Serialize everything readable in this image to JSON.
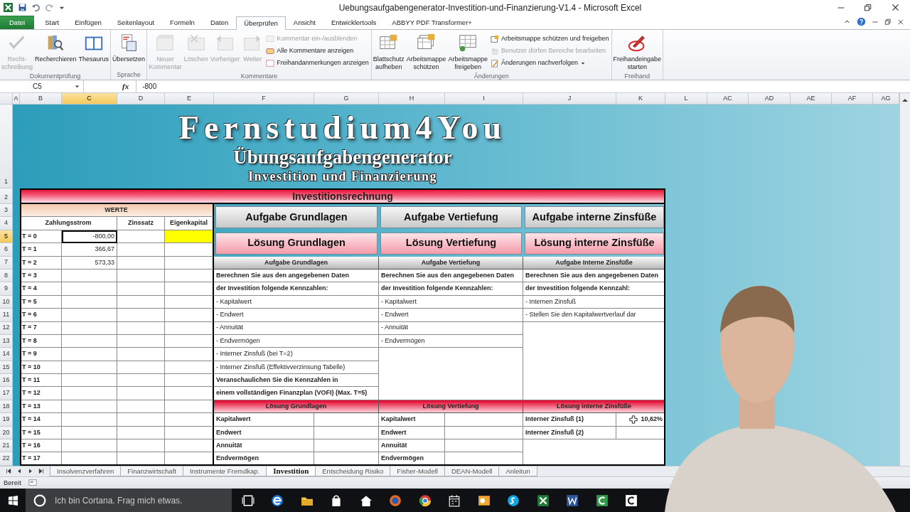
{
  "window": {
    "title": "Uebungsaufgabengenerator-Investition-und-Finanzierung-V1.4  -  Microsoft Excel"
  },
  "ribbon_tabs": [
    {
      "label": "Datei",
      "kind": "file",
      "selected": false
    },
    {
      "label": "Start",
      "kind": "tab",
      "selected": false
    },
    {
      "label": "Einfügen",
      "kind": "tab",
      "selected": false
    },
    {
      "label": "Seitenlayout",
      "kind": "tab",
      "selected": false
    },
    {
      "label": "Formeln",
      "kind": "tab",
      "selected": false
    },
    {
      "label": "Daten",
      "kind": "tab",
      "selected": false
    },
    {
      "label": "Überprüfen",
      "kind": "tab",
      "selected": true
    },
    {
      "label": "Ansicht",
      "kind": "tab",
      "selected": false
    },
    {
      "label": "Entwicklertools",
      "kind": "tab",
      "selected": false
    },
    {
      "label": "ABBYY PDF Transformer+",
      "kind": "tab",
      "selected": false
    }
  ],
  "ribbon_groups": [
    {
      "label": "Dokumentprüfung",
      "buttons": [
        {
          "label": "Recht-\nschreibung",
          "disabled": true
        },
        {
          "label": "Recherchieren",
          "disabled": false
        },
        {
          "label": "Thesaurus",
          "disabled": false
        }
      ]
    },
    {
      "label": "Sprache",
      "buttons": [
        {
          "label": "Übersetzen",
          "disabled": false
        }
      ]
    },
    {
      "label": "Kommentare",
      "buttons": [
        {
          "label": "Neuer\nKommentar",
          "disabled": true
        },
        {
          "label": "Löschen",
          "disabled": true
        },
        {
          "label": "Vorheriger",
          "disabled": true
        },
        {
          "label": "Weiter",
          "disabled": true
        }
      ],
      "small_buttons": [
        {
          "label": "Kommentar ein-/ausblenden",
          "disabled": true,
          "dropdown": false
        },
        {
          "label": "Alle Kommentare anzeigen",
          "disabled": false,
          "dropdown": false
        },
        {
          "label": "Freihandanmerkungen anzeigen",
          "disabled": false,
          "dropdown": false
        }
      ]
    },
    {
      "label": "Änderungen",
      "buttons": [
        {
          "label": "Blattschutz\naufheben",
          "disabled": false
        },
        {
          "label": "Arbeitsmappe\nschützen",
          "disabled": false
        },
        {
          "label": "Arbeitsmappe\nfreigeben",
          "disabled": false
        }
      ],
      "small_buttons": [
        {
          "label": "Arbeitsmappe schützen und freigeben",
          "disabled": false,
          "dropdown": false
        },
        {
          "label": "Benutzer dürfen Bereiche bearbeiten",
          "disabled": true,
          "dropdown": false
        },
        {
          "label": "Änderungen nachverfolgen",
          "disabled": false,
          "dropdown": true
        }
      ]
    },
    {
      "label": "Freihand",
      "buttons": [
        {
          "label": "Freihandeingabe\nstarten",
          "disabled": false
        }
      ]
    }
  ],
  "formula_bar": {
    "name_box": "C5",
    "fx_label": "fx",
    "value": "-800"
  },
  "columns": [
    {
      "label": "A",
      "selected": false
    },
    {
      "label": "B",
      "selected": false
    },
    {
      "label": "C",
      "selected": true
    },
    {
      "label": "D",
      "selected": false
    },
    {
      "label": "E",
      "selected": false
    },
    {
      "label": "F",
      "selected": false
    },
    {
      "label": "G",
      "selected": false
    },
    {
      "label": "H",
      "selected": false
    },
    {
      "label": "I",
      "selected": false
    },
    {
      "label": "J",
      "selected": false
    },
    {
      "label": "K",
      "selected": false
    },
    {
      "label": "L",
      "selected": false
    },
    {
      "label": "AC",
      "selected": false
    },
    {
      "label": "AD",
      "selected": false
    },
    {
      "label": "AE",
      "selected": false
    },
    {
      "label": "AF",
      "selected": false
    },
    {
      "label": "AG",
      "selected": false
    }
  ],
  "row_headers": [
    {
      "label": "1",
      "selected": false
    },
    {
      "label": "2",
      "selected": false
    },
    {
      "label": "3",
      "selected": false
    },
    {
      "label": "4",
      "selected": false
    },
    {
      "label": "5",
      "selected": true
    },
    {
      "label": "6",
      "selected": false
    },
    {
      "label": "7",
      "selected": false
    },
    {
      "label": "8",
      "selected": false
    },
    {
      "label": "9",
      "selected": false
    },
    {
      "label": "10",
      "selected": false
    },
    {
      "label": "11",
      "selected": false
    },
    {
      "label": "12",
      "selected": false
    },
    {
      "label": "13",
      "selected": false
    },
    {
      "label": "14",
      "selected": false
    },
    {
      "label": "15",
      "selected": false
    },
    {
      "label": "16",
      "selected": false
    },
    {
      "label": "17",
      "selected": false
    },
    {
      "label": "18",
      "selected": false
    },
    {
      "label": "19",
      "selected": false
    },
    {
      "label": "20",
      "selected": false
    },
    {
      "label": "21",
      "selected": false
    },
    {
      "label": "22",
      "selected": false
    }
  ],
  "banner": {
    "title": "Fernstudium4You",
    "subtitle": "Übungsaufgabengenerator",
    "tagline": "Investition und Finanzierung"
  },
  "section_title": "Investitionsrechnung",
  "werte": {
    "title": "WERTE",
    "columns": [
      "Zahlungsstrom",
      "Zinssatz",
      "Eigenkapital"
    ],
    "rows": [
      {
        "label": "T = 0",
        "zahlungsstrom": "-800,00",
        "active": true,
        "highlight": true
      },
      {
        "label": "T = 1",
        "zahlungsstrom": "366,67",
        "active": false,
        "highlight": false
      },
      {
        "label": "T = 2",
        "zahlungsstrom": "573,33",
        "active": false,
        "highlight": false
      },
      {
        "label": "T = 3",
        "active": false,
        "highlight": false
      },
      {
        "label": "T = 4",
        "active": false,
        "highlight": false
      },
      {
        "label": "T = 5",
        "active": false,
        "highlight": false
      },
      {
        "label": "T = 6",
        "active": false,
        "highlight": false
      },
      {
        "label": "T = 7",
        "active": false,
        "highlight": false
      },
      {
        "label": "T = 8",
        "active": false,
        "highlight": false
      },
      {
        "label": "T = 9",
        "active": false,
        "highlight": false
      },
      {
        "label": "T = 10",
        "active": false,
        "highlight": false
      },
      {
        "label": "T = 11",
        "active": false,
        "highlight": false
      },
      {
        "label": "T = 12",
        "active": false,
        "highlight": false
      },
      {
        "label": "T = 13",
        "active": false,
        "highlight": false
      },
      {
        "label": "T = 14",
        "active": false,
        "highlight": false
      },
      {
        "label": "T = 15",
        "active": false,
        "highlight": false
      },
      {
        "label": "T = 16",
        "active": false,
        "highlight": false
      },
      {
        "label": "T = 17",
        "active": false,
        "highlight": false
      }
    ]
  },
  "panels": [
    {
      "aufgabe_button": "Aufgabe Grundlagen",
      "loesung_button": "Lösung Grundlagen",
      "aufgabe_title": "Aufgabe Grundlagen",
      "lines": [
        {
          "text": "Berechnen Sie aus den angegebenen Daten",
          "kind": "instruction"
        },
        {
          "text": "der Investition folgende Kennzahlen:",
          "kind": "instruction"
        },
        {
          "text": "- Kapitalwert",
          "kind": "item"
        },
        {
          "text": "- Endwert",
          "kind": "item"
        },
        {
          "text": "- Annuität",
          "kind": "item"
        },
        {
          "text": "- Endvermögen",
          "kind": "item"
        },
        {
          "text": "- Interner Zinsfuß (bei T=2)",
          "kind": "item"
        },
        {
          "text": "- Interner Zinsfuß (Effektivverzinsung Tabelle)",
          "kind": "item"
        },
        {
          "text": "Veranschaulichen Sie die Kennzahlen in",
          "kind": "instruction"
        },
        {
          "text": "einem vollständigen Finanzplan (VOFI) (Max. T=5)",
          "kind": "instruction"
        }
      ],
      "loesung_title": "Lösung Grundlagen",
      "results": [
        {
          "label": "Kapitalwert"
        },
        {
          "label": "Endwert"
        },
        {
          "label": "Annuität"
        },
        {
          "label": "Endvermögen"
        }
      ]
    },
    {
      "aufgabe_button": "Aufgabe Vertiefung",
      "loesung_button": "Lösung Vertiefung",
      "aufgabe_title": "Aufgabe Vertiefung",
      "lines": [
        {
          "text": "Berechnen Sie aus den angegebenen Daten",
          "kind": "instruction"
        },
        {
          "text": "der Investition folgende Kennzahlen:",
          "kind": "instruction"
        },
        {
          "text": "- Kapitalwert",
          "kind": "item"
        },
        {
          "text": "- Endwert",
          "kind": "item"
        },
        {
          "text": "- Annuität",
          "kind": "item"
        },
        {
          "text": "- Endvermögen",
          "kind": "item"
        }
      ],
      "loesung_title": "Lösung Vertiefung",
      "results": [
        {
          "label": "Kapitalwert"
        },
        {
          "label": "Endwert"
        },
        {
          "label": "Annuität"
        },
        {
          "label": "Endvermögen"
        }
      ]
    },
    {
      "aufgabe_button": "Aufgabe interne Zinsfüße",
      "loesung_button": "Lösung interne Zinsfüße",
      "aufgabe_title": "Aufgabe Interne Zinsfüße",
      "lines": [
        {
          "text": "Berechnen Sie aus den angegebenen Daten",
          "kind": "instruction"
        },
        {
          "text": "der Investition folgende Kennzahl:",
          "kind": "instruction"
        },
        {
          "text": "- Internen Zinsfuß",
          "kind": "item"
        },
        {
          "text": "- Stellen Sie den Kapitalwertverlauf dar",
          "kind": "item"
        }
      ],
      "loesung_title": "Lösung interne Zinsfüße",
      "results": [
        {
          "label": "Interner Zinsfuß (1)",
          "value": "10,62%"
        },
        {
          "label": "Interner Zinsfuß (2)"
        }
      ]
    }
  ],
  "sheet_tabs": [
    {
      "label": "Insolvenzverfahren",
      "selected": false
    },
    {
      "label": "Finanzwirtschaft",
      "selected": false
    },
    {
      "label": "Instrumente Fremdkap.",
      "selected": false
    },
    {
      "label": "Investition",
      "selected": true
    },
    {
      "label": "Entscheidung Risiko",
      "selected": false
    },
    {
      "label": "Fisher-Modell",
      "selected": false
    },
    {
      "label": "DEAN-Modell",
      "selected": false
    },
    {
      "label": "Anleitun",
      "selected": false
    }
  ],
  "status_bar": {
    "text": "Bereit"
  },
  "taskbar": {
    "search_placeholder": "Ich bin Cortana. Frag mich etwas."
  }
}
